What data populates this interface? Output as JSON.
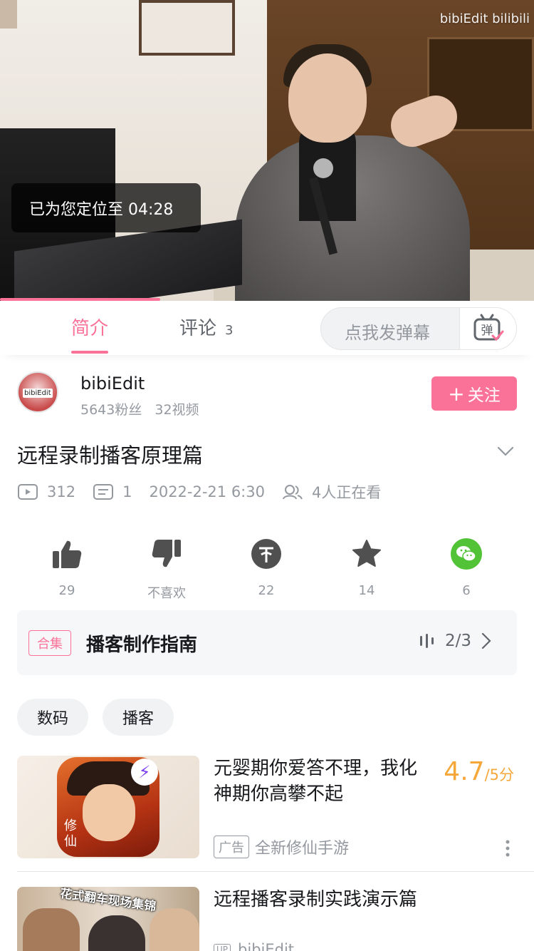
{
  "player": {
    "watermark": "bibiEdit bilibili",
    "toast": "已为您定位至 04:28",
    "progress_fraction": 0.3
  },
  "tabs": {
    "intro_label": "简介",
    "comments_label": "评论",
    "comments_count": "3",
    "danmaku_placeholder": "点我发弹幕",
    "danmaku_icon_text": "弹"
  },
  "uploader": {
    "name": "bibiEdit",
    "fans": "5643粉丝",
    "videos": "32视频",
    "follow_label": "关注",
    "avatar_text": "bibiEdit"
  },
  "video": {
    "title": "远程录制播客原理篇",
    "views": "312",
    "danmaku_count": "1",
    "publish_time": "2022-2-21 6:30",
    "watching": "4人正在看"
  },
  "actions": [
    {
      "icon": "like-icon",
      "label": "29"
    },
    {
      "icon": "dislike-icon",
      "label": "不喜欢"
    },
    {
      "icon": "coin-icon",
      "label": "22"
    },
    {
      "icon": "favorite-icon",
      "label": "14"
    },
    {
      "icon": "wechat-share-icon",
      "label": "6"
    }
  ],
  "collection": {
    "tag": "合集",
    "title": "播客制作指南",
    "progress": "2/3"
  },
  "tags": [
    "数码",
    "播客"
  ],
  "ad": {
    "title": "元婴期你爱答不理，我化神期你高攀不起",
    "score": "4.7",
    "score_unit": "/5分",
    "badge": "广告",
    "source": "全新修仙手游",
    "thumb_text": "修仙"
  },
  "related": {
    "title": "远程播客录制实践演示篇",
    "up_badge": "UP",
    "author": "bibiEdit",
    "thumb_banner": "花式翻车现场集锦"
  },
  "colors": {
    "accent": "#fb7299",
    "score": "#f6a73a",
    "wechat": "#52c236",
    "icon_dark": "#505050"
  }
}
